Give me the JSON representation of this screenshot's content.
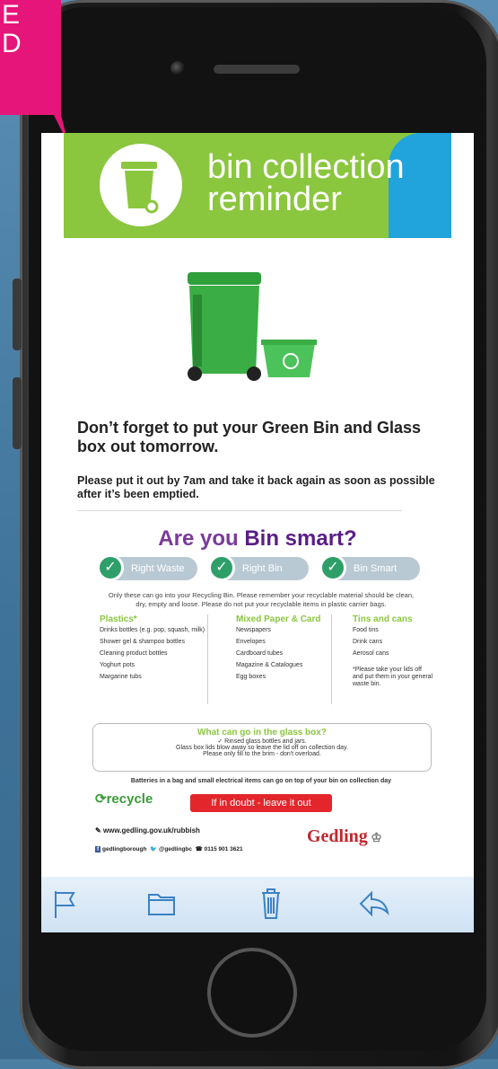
{
  "badge": {
    "text": "E\nD",
    "color": "#e6157a"
  },
  "email": {
    "banner_line1": "bin collection",
    "banner_line2": "reminder",
    "headline": "Don’t forget to put your Green Bin and Glass box out tomorrow.",
    "subtext": "Please put it out by 7am and take it back again as soon as possible after it’s been emptied.",
    "smart_title_pre": "Are you ",
    "smart_title_bold": "Bin smart?",
    "pills": [
      "Right Waste",
      "Right Bin",
      "Bin Smart"
    ],
    "intro": "Only these can go into your Recycling Bin. Please remember your recyclable material should be clean, dry, empty and loose. Please do not put your recyclable items in plastic carrier bags.",
    "columns": [
      {
        "title": "Plastics*",
        "items": [
          "Drinks bottles (e.g. pop, squash, milk)",
          "Shower gel & shampoo bottles",
          "Cleaning product bottles",
          "Yoghurt pots",
          "Margarine tubs"
        ]
      },
      {
        "title": "Mixed Paper & Card",
        "items": [
          "Newspapers",
          "Envelopes",
          "Cardboard tubes",
          "Magazine & Catalogues",
          "Egg boxes"
        ]
      },
      {
        "title": "Tins and cans",
        "items": [
          "Food tins",
          "Drink cans",
          "Aerosol cans"
        ],
        "note": "*Please take your lids off and put them in your general waste bin."
      }
    ],
    "glass_title": "What can go in the glass box?",
    "glass_line1": "✓ Rinsed glass bottles and jars.",
    "glass_line2": "Glass box lids blow away so leave the lid off on collection day.",
    "glass_line3": "Please only fill to the brim - don't overload.",
    "batteries": "Batteries in a bag and small electrical items can go on top of your bin on collection day",
    "recycle_label": "recycle",
    "doubt_label": "If in doubt - leave it out",
    "website": "www.gedling.gov.uk/rubbish",
    "facebook": "gedlingborough",
    "twitter": "@gedlingbc",
    "phone": "0115 901 3621",
    "council": "Gedling"
  },
  "toolbar": {
    "icons": [
      "flag-icon",
      "folder-icon",
      "trash-icon",
      "reply-icon"
    ]
  },
  "colors": {
    "green": "#8bc63f",
    "blue": "#21a3dc",
    "purple": "#5a1e88",
    "red": "#e2262b",
    "toolbar": "#dbe9f7"
  }
}
